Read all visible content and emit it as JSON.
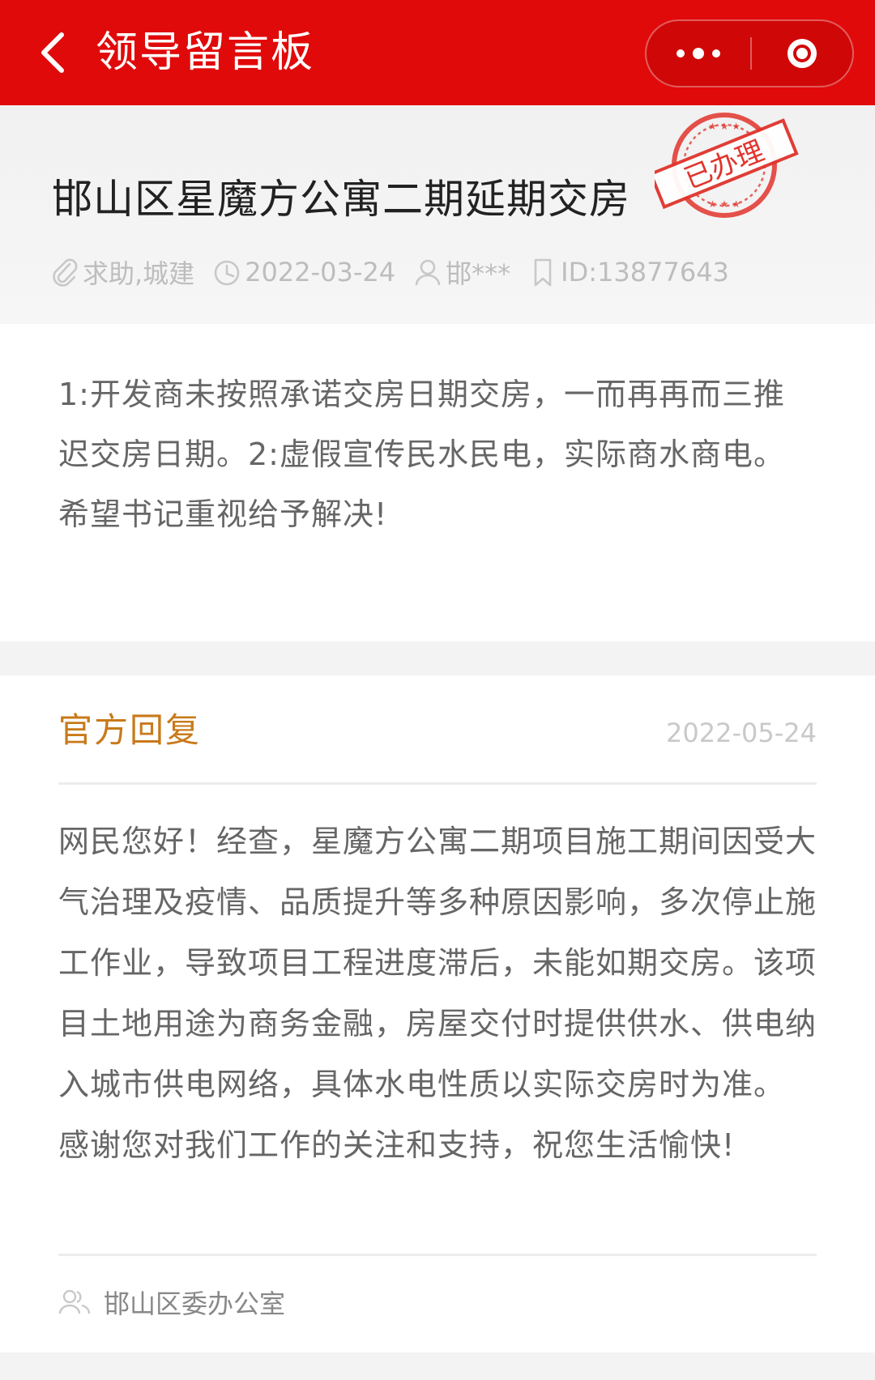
{
  "nav": {
    "title": "领导留言板"
  },
  "message": {
    "title": "邯山区星魔方公寓二期延期交房",
    "stamp_text": "已办理",
    "category": "求助,城建",
    "date": "2022-03-24",
    "author": "邯***",
    "id": "ID:13877643",
    "content": "1:开发商未按照承诺交房日期交房，一而再再而三推迟交房日期。2:虚假宣传民水民电，实际商水商电。希望书记重视给予解决!"
  },
  "reply": {
    "title": "官方回复",
    "date": "2022-05-24",
    "content": "网民您好！经查，星魔方公寓二期项目施工期间因受大气治理及疫情、品质提升等多种原因影响，多次停止施工作业，导致项目工程进度滞后，未能如期交房。该项目土地用途为商务金融，房屋交付时提供供水、供电纳入城市供电网络，具体水电性质以实际交房时为准。 感谢您对我们工作的关注和支持，祝您生活愉快!",
    "department": "邯山区委办公室"
  },
  "colors": {
    "nav_bg": "#e10a0a",
    "stamp": "#e0342c",
    "reply_title": "#c87a1a"
  },
  "icons": [
    "back-arrow-icon",
    "more-dots-icon",
    "close-circle-icon",
    "paperclip-icon",
    "clock-icon",
    "user-icon",
    "bookmark-icon",
    "users-icon"
  ]
}
